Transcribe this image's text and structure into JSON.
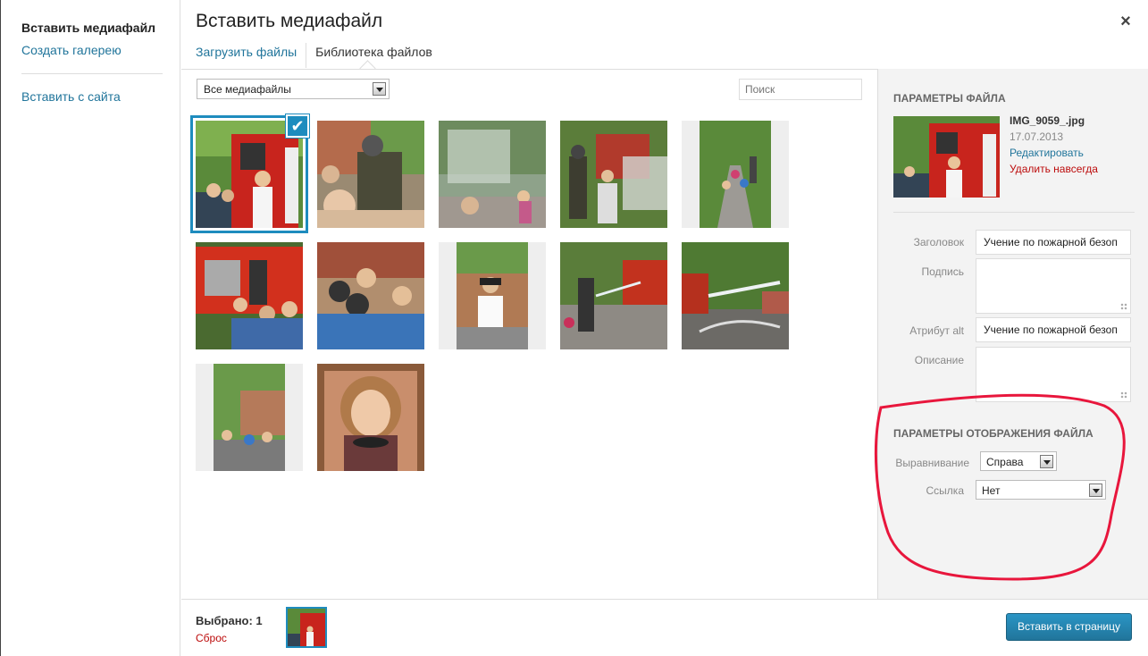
{
  "menu": {
    "title": "Вставить медиафайл",
    "create_gallery": "Создать галерею",
    "insert_from_url": "Вставить с сайта"
  },
  "header": {
    "title": "Вставить медиафайл",
    "close": "×",
    "tabs": [
      {
        "label": "Загрузить файлы",
        "active": false
      },
      {
        "label": "Библиотека файлов",
        "active": true
      }
    ]
  },
  "toolbar": {
    "filter_value": "Все медиафайлы",
    "search_placeholder": "Поиск"
  },
  "attachments": [
    {
      "name": "thumb-1",
      "selected": true,
      "icon": "fire-truck-with-woman-and-children"
    },
    {
      "name": "thumb-2",
      "selected": false,
      "icon": "fireman-with-children"
    },
    {
      "name": "thumb-3",
      "selected": false,
      "icon": "water-spray-children"
    },
    {
      "name": "thumb-4",
      "selected": false,
      "icon": "firemen-with-smoke"
    },
    {
      "name": "thumb-5",
      "selected": false,
      "icon": "children-walking-path"
    },
    {
      "name": "thumb-6",
      "selected": false,
      "icon": "fire-truck-children"
    },
    {
      "name": "thumb-7",
      "selected": false,
      "icon": "children-in-helmets"
    },
    {
      "name": "thumb-8",
      "selected": false,
      "icon": "woman-in-helmet"
    },
    {
      "name": "thumb-9",
      "selected": false,
      "icon": "fireman-hose-spray"
    },
    {
      "name": "thumb-10",
      "selected": false,
      "icon": "hose-spray-yard"
    },
    {
      "name": "thumb-11",
      "selected": false,
      "icon": "children-by-building"
    },
    {
      "name": "thumb-12",
      "selected": false,
      "icon": "woman-portrait"
    }
  ],
  "sidebar": {
    "file_params_heading": "ПАРАМЕТРЫ ФАЙЛА",
    "filename": "IMG_9059_.jpg",
    "date": "17.07.2013",
    "edit": "Редактировать",
    "delete": "Удалить навсегда",
    "fields": {
      "title_label": "Заголовок",
      "title_value": "Учение по пожарной безоп",
      "caption_label": "Подпись",
      "caption_value": "",
      "alt_label": "Атрибут alt",
      "alt_value": "Учение по пожарной безоп",
      "description_label": "Описание",
      "description_value": ""
    },
    "display_heading": "ПАРАМЕТРЫ ОТОБРАЖЕНИЯ ФАЙЛА",
    "align_label": "Выравнивание",
    "align_value": "Справа",
    "link_label": "Ссылка",
    "link_value": "Нет"
  },
  "footer": {
    "selected_count": "Выбрано: 1",
    "reset": "Сброс",
    "insert_button": "Вставить в страницу"
  },
  "colors": {
    "accent": "#1e8cbe",
    "link": "#21759b",
    "danger": "#bc0b0b",
    "annotation": "#e8163c"
  }
}
